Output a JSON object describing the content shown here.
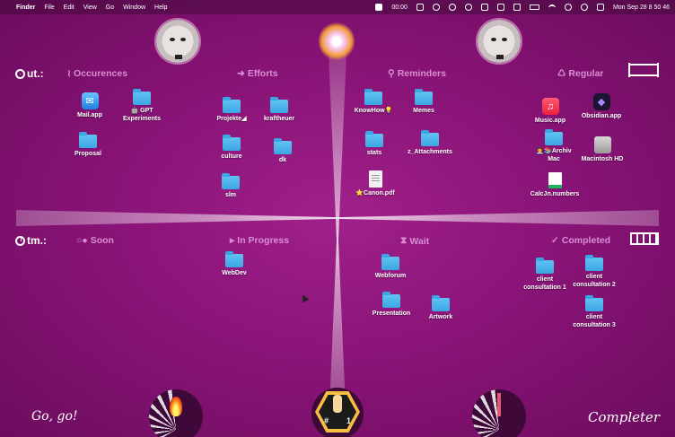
{
  "menubar": {
    "apple": "",
    "app_name": "Finder",
    "menus": [
      "File",
      "Edit",
      "View",
      "Go",
      "Window",
      "Help"
    ],
    "timer": "00:00",
    "datetime": "Mon Sep 28  8 50 46"
  },
  "colors": {
    "background": "#8a1478",
    "header_text": "#d98fd3",
    "folder": "#3aa6e4"
  },
  "row_labels": {
    "top": "ut.:",
    "bottom": "tm.:"
  },
  "sections": {
    "top": [
      {
        "icon": "≀",
        "label": "Occurences"
      },
      {
        "icon": "➜",
        "label": "Efforts"
      },
      {
        "icon": "⚲",
        "label": "Reminders"
      },
      {
        "icon": "♺",
        "label": "Regular"
      }
    ],
    "bottom": [
      {
        "icon": "○●",
        "label": "Soon"
      },
      {
        "icon": "▸",
        "label": "In Progress"
      },
      {
        "icon": "⧗",
        "label": "Wait"
      },
      {
        "icon": "✓",
        "label": "Completed"
      }
    ]
  },
  "items": {
    "mail": "Mail.app",
    "gpt": "🤖 GPT Experiments",
    "proposal": "Proposal",
    "projekte": "Projekte◢",
    "kraftheuer": "kraftheuer",
    "culture": "culture",
    "dk": "dk",
    "slm": "slm",
    "knowhow": "KnowHow💡",
    "memes": "Memes",
    "stats": "stats",
    "attachments": "z_Attachments",
    "canon": "⭐Canon.pdf",
    "music": "Music.app",
    "obsidian": "Obsidian.app",
    "archiv": "👨‍💼📚Archiv Mac",
    "macintosh": "Macintosh HD",
    "calcjn": "CalcJn.numbers",
    "webdev": "WebDev",
    "webforum": "Webforum",
    "presentation": "Presentation",
    "artwork": "Artwork",
    "client1": "client consultation 1",
    "client2": "client consultation 2",
    "client3": "client consultation 3"
  },
  "bottom": {
    "left_text": "Go, go!",
    "right_text": "Completer",
    "badge_left": "#",
    "badge_right": "1"
  }
}
